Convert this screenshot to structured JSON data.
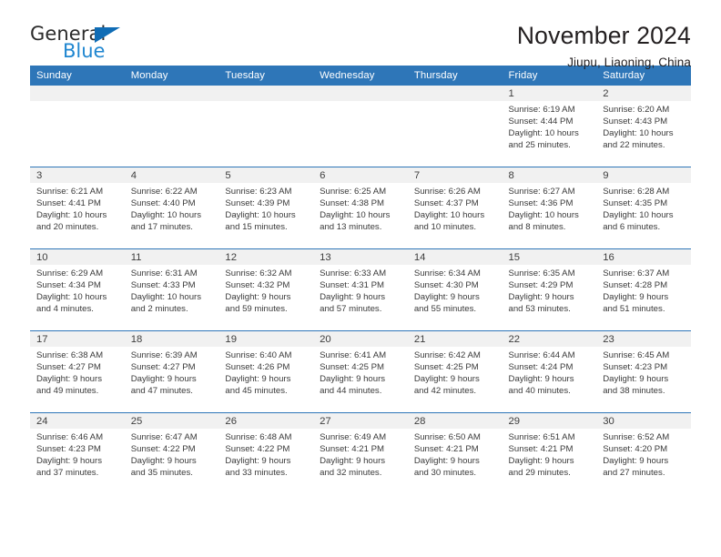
{
  "brand": {
    "name_part1": "General",
    "name_part2": "Blue",
    "accent_color": "#1f86d0",
    "triangle_color": "#0f6cb5"
  },
  "header": {
    "title": "November 2024",
    "subtitle": "Jiupu, Liaoning, China",
    "header_row_color": "#2e76b8"
  },
  "weekdays": [
    "Sunday",
    "Monday",
    "Tuesday",
    "Wednesday",
    "Thursday",
    "Friday",
    "Saturday"
  ],
  "weeks": [
    [
      {
        "day": "",
        "sunrise": "",
        "sunset": "",
        "daylight_line1": "",
        "daylight_line2": ""
      },
      {
        "day": "",
        "sunrise": "",
        "sunset": "",
        "daylight_line1": "",
        "daylight_line2": ""
      },
      {
        "day": "",
        "sunrise": "",
        "sunset": "",
        "daylight_line1": "",
        "daylight_line2": ""
      },
      {
        "day": "",
        "sunrise": "",
        "sunset": "",
        "daylight_line1": "",
        "daylight_line2": ""
      },
      {
        "day": "",
        "sunrise": "",
        "sunset": "",
        "daylight_line1": "",
        "daylight_line2": ""
      },
      {
        "day": "1",
        "sunrise": "Sunrise: 6:19 AM",
        "sunset": "Sunset: 4:44 PM",
        "daylight_line1": "Daylight: 10 hours",
        "daylight_line2": "and 25 minutes."
      },
      {
        "day": "2",
        "sunrise": "Sunrise: 6:20 AM",
        "sunset": "Sunset: 4:43 PM",
        "daylight_line1": "Daylight: 10 hours",
        "daylight_line2": "and 22 minutes."
      }
    ],
    [
      {
        "day": "3",
        "sunrise": "Sunrise: 6:21 AM",
        "sunset": "Sunset: 4:41 PM",
        "daylight_line1": "Daylight: 10 hours",
        "daylight_line2": "and 20 minutes."
      },
      {
        "day": "4",
        "sunrise": "Sunrise: 6:22 AM",
        "sunset": "Sunset: 4:40 PM",
        "daylight_line1": "Daylight: 10 hours",
        "daylight_line2": "and 17 minutes."
      },
      {
        "day": "5",
        "sunrise": "Sunrise: 6:23 AM",
        "sunset": "Sunset: 4:39 PM",
        "daylight_line1": "Daylight: 10 hours",
        "daylight_line2": "and 15 minutes."
      },
      {
        "day": "6",
        "sunrise": "Sunrise: 6:25 AM",
        "sunset": "Sunset: 4:38 PM",
        "daylight_line1": "Daylight: 10 hours",
        "daylight_line2": "and 13 minutes."
      },
      {
        "day": "7",
        "sunrise": "Sunrise: 6:26 AM",
        "sunset": "Sunset: 4:37 PM",
        "daylight_line1": "Daylight: 10 hours",
        "daylight_line2": "and 10 minutes."
      },
      {
        "day": "8",
        "sunrise": "Sunrise: 6:27 AM",
        "sunset": "Sunset: 4:36 PM",
        "daylight_line1": "Daylight: 10 hours",
        "daylight_line2": "and 8 minutes."
      },
      {
        "day": "9",
        "sunrise": "Sunrise: 6:28 AM",
        "sunset": "Sunset: 4:35 PM",
        "daylight_line1": "Daylight: 10 hours",
        "daylight_line2": "and 6 minutes."
      }
    ],
    [
      {
        "day": "10",
        "sunrise": "Sunrise: 6:29 AM",
        "sunset": "Sunset: 4:34 PM",
        "daylight_line1": "Daylight: 10 hours",
        "daylight_line2": "and 4 minutes."
      },
      {
        "day": "11",
        "sunrise": "Sunrise: 6:31 AM",
        "sunset": "Sunset: 4:33 PM",
        "daylight_line1": "Daylight: 10 hours",
        "daylight_line2": "and 2 minutes."
      },
      {
        "day": "12",
        "sunrise": "Sunrise: 6:32 AM",
        "sunset": "Sunset: 4:32 PM",
        "daylight_line1": "Daylight: 9 hours",
        "daylight_line2": "and 59 minutes."
      },
      {
        "day": "13",
        "sunrise": "Sunrise: 6:33 AM",
        "sunset": "Sunset: 4:31 PM",
        "daylight_line1": "Daylight: 9 hours",
        "daylight_line2": "and 57 minutes."
      },
      {
        "day": "14",
        "sunrise": "Sunrise: 6:34 AM",
        "sunset": "Sunset: 4:30 PM",
        "daylight_line1": "Daylight: 9 hours",
        "daylight_line2": "and 55 minutes."
      },
      {
        "day": "15",
        "sunrise": "Sunrise: 6:35 AM",
        "sunset": "Sunset: 4:29 PM",
        "daylight_line1": "Daylight: 9 hours",
        "daylight_line2": "and 53 minutes."
      },
      {
        "day": "16",
        "sunrise": "Sunrise: 6:37 AM",
        "sunset": "Sunset: 4:28 PM",
        "daylight_line1": "Daylight: 9 hours",
        "daylight_line2": "and 51 minutes."
      }
    ],
    [
      {
        "day": "17",
        "sunrise": "Sunrise: 6:38 AM",
        "sunset": "Sunset: 4:27 PM",
        "daylight_line1": "Daylight: 9 hours",
        "daylight_line2": "and 49 minutes."
      },
      {
        "day": "18",
        "sunrise": "Sunrise: 6:39 AM",
        "sunset": "Sunset: 4:27 PM",
        "daylight_line1": "Daylight: 9 hours",
        "daylight_line2": "and 47 minutes."
      },
      {
        "day": "19",
        "sunrise": "Sunrise: 6:40 AM",
        "sunset": "Sunset: 4:26 PM",
        "daylight_line1": "Daylight: 9 hours",
        "daylight_line2": "and 45 minutes."
      },
      {
        "day": "20",
        "sunrise": "Sunrise: 6:41 AM",
        "sunset": "Sunset: 4:25 PM",
        "daylight_line1": "Daylight: 9 hours",
        "daylight_line2": "and 44 minutes."
      },
      {
        "day": "21",
        "sunrise": "Sunrise: 6:42 AM",
        "sunset": "Sunset: 4:25 PM",
        "daylight_line1": "Daylight: 9 hours",
        "daylight_line2": "and 42 minutes."
      },
      {
        "day": "22",
        "sunrise": "Sunrise: 6:44 AM",
        "sunset": "Sunset: 4:24 PM",
        "daylight_line1": "Daylight: 9 hours",
        "daylight_line2": "and 40 minutes."
      },
      {
        "day": "23",
        "sunrise": "Sunrise: 6:45 AM",
        "sunset": "Sunset: 4:23 PM",
        "daylight_line1": "Daylight: 9 hours",
        "daylight_line2": "and 38 minutes."
      }
    ],
    [
      {
        "day": "24",
        "sunrise": "Sunrise: 6:46 AM",
        "sunset": "Sunset: 4:23 PM",
        "daylight_line1": "Daylight: 9 hours",
        "daylight_line2": "and 37 minutes."
      },
      {
        "day": "25",
        "sunrise": "Sunrise: 6:47 AM",
        "sunset": "Sunset: 4:22 PM",
        "daylight_line1": "Daylight: 9 hours",
        "daylight_line2": "and 35 minutes."
      },
      {
        "day": "26",
        "sunrise": "Sunrise: 6:48 AM",
        "sunset": "Sunset: 4:22 PM",
        "daylight_line1": "Daylight: 9 hours",
        "daylight_line2": "and 33 minutes."
      },
      {
        "day": "27",
        "sunrise": "Sunrise: 6:49 AM",
        "sunset": "Sunset: 4:21 PM",
        "daylight_line1": "Daylight: 9 hours",
        "daylight_line2": "and 32 minutes."
      },
      {
        "day": "28",
        "sunrise": "Sunrise: 6:50 AM",
        "sunset": "Sunset: 4:21 PM",
        "daylight_line1": "Daylight: 9 hours",
        "daylight_line2": "and 30 minutes."
      },
      {
        "day": "29",
        "sunrise": "Sunrise: 6:51 AM",
        "sunset": "Sunset: 4:21 PM",
        "daylight_line1": "Daylight: 9 hours",
        "daylight_line2": "and 29 minutes."
      },
      {
        "day": "30",
        "sunrise": "Sunrise: 6:52 AM",
        "sunset": "Sunset: 4:20 PM",
        "daylight_line1": "Daylight: 9 hours",
        "daylight_line2": "and 27 minutes."
      }
    ]
  ]
}
